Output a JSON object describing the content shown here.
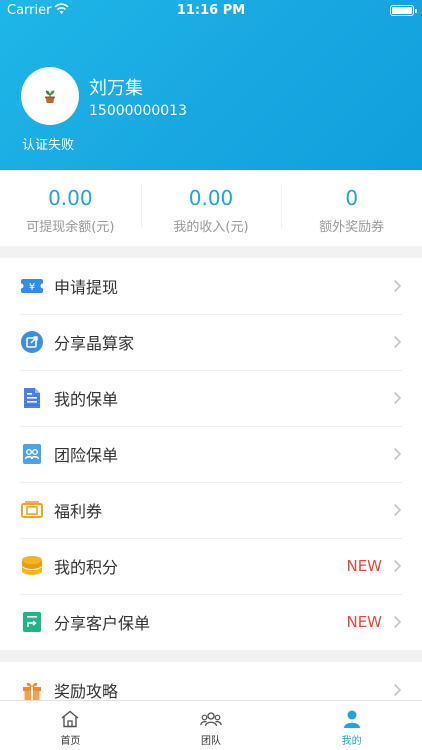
{
  "status_bar": {
    "carrier": "Carrier",
    "time": "11:16 PM"
  },
  "profile": {
    "name": "刘万集",
    "phone": "15000000013",
    "verification_status": "认证失败"
  },
  "stats": [
    {
      "value": "0.00",
      "label": "可提现余额(元)"
    },
    {
      "value": "0.00",
      "label": "我的收入(元)"
    },
    {
      "value": "0",
      "label": "额外奖励券"
    }
  ],
  "menu": {
    "withdraw": "申请提现",
    "share_app": "分享晶算家",
    "my_policy": "我的保单",
    "group_policy": "团险保单",
    "coupons": "福利券",
    "my_points": "我的积分",
    "my_points_badge": "NEW",
    "share_client_policy": "分享客户保单",
    "share_client_policy_badge": "NEW",
    "reward_guide": "奖励攻略"
  },
  "tabs": {
    "home": "首页",
    "team": "团队",
    "mine": "我的"
  },
  "colors": {
    "accent": "#1da6d8",
    "badge": "#e64a3b",
    "header": "#17a6e0"
  }
}
